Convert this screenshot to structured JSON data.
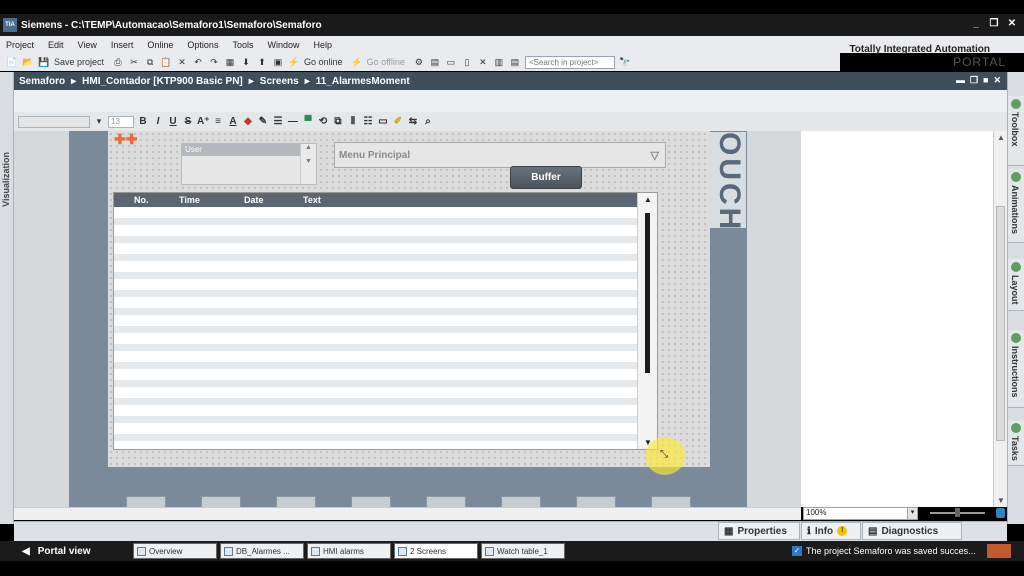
{
  "window": {
    "title": "Siemens - C:\\TEMP\\Automacao\\Semaforo1\\Semaforo\\Semaforo",
    "logo_text": "TIA"
  },
  "menu": [
    "Project",
    "Edit",
    "View",
    "Insert",
    "Online",
    "Options",
    "Tools",
    "Window",
    "Help"
  ],
  "brand": {
    "name": "Totally Integrated Automation",
    "portal": "PORTAL"
  },
  "toolbar": {
    "save_label": "Save project",
    "go_online": "Go online",
    "go_offline": "Go offline",
    "search_placeholder": "<Search in project>"
  },
  "breadcrumb": [
    "Semaforo",
    "HMI_Contador [KTP900 Basic PN]",
    "Screens",
    "11_AlarmesMoment"
  ],
  "left_panel": {
    "label": "Visualization"
  },
  "task_cards": [
    "Toolbox",
    "Animations",
    "Layout",
    "Instructions",
    "Tasks"
  ],
  "format": {
    "font_size": "13"
  },
  "hmi": {
    "user_header": "User",
    "menu_principal": "Menu Principal",
    "buffer_button": "Buffer",
    "touch_text": "OUCH",
    "alarm_columns": [
      "No.",
      "Time",
      "Date",
      "Text"
    ]
  },
  "zoom": "100%",
  "inspector": {
    "properties": "Properties",
    "info": "Info",
    "diagnostics": "Diagnostics"
  },
  "taskbar": {
    "portal_view": "Portal view",
    "tasks": [
      "Overview",
      "DB_Alarmes ...",
      "HMI alarms",
      "2 Screens",
      "Watch table_1"
    ],
    "status": "The project Semaforo was saved succes..."
  }
}
